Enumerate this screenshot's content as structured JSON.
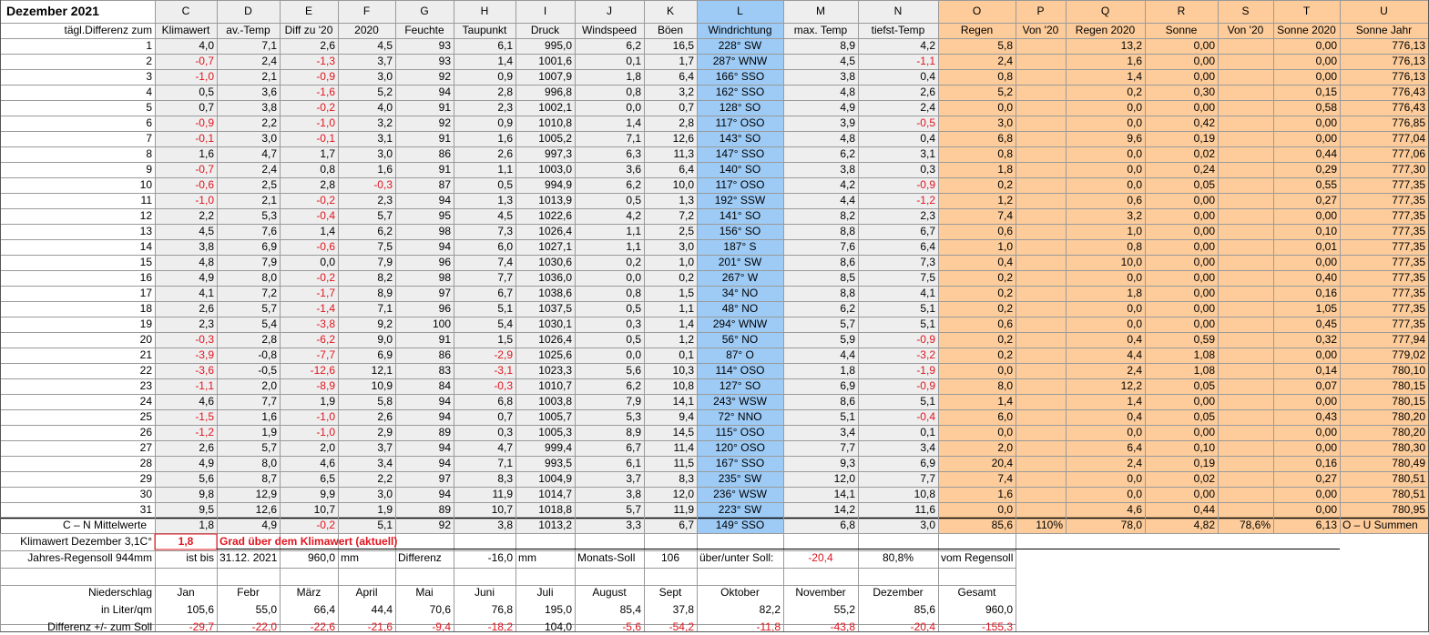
{
  "title": "Dezember 2021",
  "colors": {
    "gray": "#eeeeee",
    "blue": "#9dcbf6",
    "orange": "#fdcc9a",
    "red": "#e0141e",
    "grid": "#9a9a9a"
  },
  "letters": [
    "C",
    "D",
    "E",
    "F",
    "G",
    "H",
    "I",
    "J",
    "K",
    "L",
    "M",
    "N",
    "O",
    "P",
    "Q",
    "R",
    "S",
    "T",
    "U"
  ],
  "headers": [
    "Klimawert",
    "av.-Temp",
    "Diff zu '20",
    "2020",
    "Feuchte",
    "Taupunkt",
    "Druck",
    "Windspeed",
    "Böen",
    "Windrichtung",
    "max. Temp",
    "tiefst-Temp",
    "Regen",
    "Von '20",
    "Regen 2020",
    "Sonne",
    "Von '20",
    "Sonne 2020",
    "Sonne Jahr"
  ],
  "row_header_label": "tägl.Differenz zum",
  "rows": [
    [
      "1",
      "4,0",
      "7,1",
      "2,6",
      "4,5",
      "93",
      "6,1",
      "995,0",
      "6,2",
      "16,5",
      "228° SW",
      "8,9",
      "4,2",
      "5,8",
      "",
      "13,2",
      "0,00",
      "",
      "0,00",
      "776,13"
    ],
    [
      "2",
      "-0,7",
      "2,4",
      "-1,3",
      "3,7",
      "93",
      "1,4",
      "1001,6",
      "0,1",
      "1,7",
      "287° WNW",
      "4,5",
      "-1,1",
      "2,4",
      "",
      "1,6",
      "0,00",
      "",
      "0,00",
      "776,13"
    ],
    [
      "3",
      "-1,0",
      "2,1",
      "-0,9",
      "3,0",
      "92",
      "0,9",
      "1007,9",
      "1,8",
      "6,4",
      "166° SSO",
      "3,8",
      "0,4",
      "0,8",
      "",
      "1,4",
      "0,00",
      "",
      "0,00",
      "776,13"
    ],
    [
      "4",
      "0,5",
      "3,6",
      "-1,6",
      "5,2",
      "94",
      "2,8",
      "996,8",
      "0,8",
      "3,2",
      "162° SSO",
      "4,8",
      "2,6",
      "5,2",
      "",
      "0,2",
      "0,30",
      "",
      "0,15",
      "776,43"
    ],
    [
      "5",
      "0,7",
      "3,8",
      "-0,2",
      "4,0",
      "91",
      "2,3",
      "1002,1",
      "0,0",
      "0,7",
      "128° SO",
      "4,9",
      "2,4",
      "0,0",
      "",
      "0,0",
      "0,00",
      "",
      "0,58",
      "776,43"
    ],
    [
      "6",
      "-0,9",
      "2,2",
      "-1,0",
      "3,2",
      "92",
      "0,9",
      "1010,8",
      "1,4",
      "2,8",
      "117° OSO",
      "3,9",
      "-0,5",
      "3,0",
      "",
      "0,0",
      "0,42",
      "",
      "0,00",
      "776,85"
    ],
    [
      "7",
      "-0,1",
      "3,0",
      "-0,1",
      "3,1",
      "91",
      "1,6",
      "1005,2",
      "7,1",
      "12,6",
      "143° SO",
      "4,8",
      "0,4",
      "6,8",
      "",
      "9,6",
      "0,19",
      "",
      "0,00",
      "777,04"
    ],
    [
      "8",
      "1,6",
      "4,7",
      "1,7",
      "3,0",
      "86",
      "2,6",
      "997,3",
      "6,3",
      "11,3",
      "147° SSO",
      "6,2",
      "3,1",
      "0,8",
      "",
      "0,0",
      "0,02",
      "",
      "0,44",
      "777,06"
    ],
    [
      "9",
      "-0,7",
      "2,4",
      "0,8",
      "1,6",
      "91",
      "1,1",
      "1003,0",
      "3,6",
      "6,4",
      "140° SO",
      "3,8",
      "0,3",
      "1,8",
      "",
      "0,0",
      "0,24",
      "",
      "0,29",
      "777,30"
    ],
    [
      "10",
      "-0,6",
      "2,5",
      "2,8",
      "-0,3",
      "87",
      "0,5",
      "994,9",
      "6,2",
      "10,0",
      "117° OSO",
      "4,2",
      "-0,9",
      "0,2",
      "",
      "0,0",
      "0,05",
      "",
      "0,55",
      "777,35"
    ],
    [
      "11",
      "-1,0",
      "2,1",
      "-0,2",
      "2,3",
      "94",
      "1,3",
      "1013,9",
      "0,5",
      "1,3",
      "192° SSW",
      "4,4",
      "-1,2",
      "1,2",
      "",
      "0,6",
      "0,00",
      "",
      "0,27",
      "777,35"
    ],
    [
      "12",
      "2,2",
      "5,3",
      "-0,4",
      "5,7",
      "95",
      "4,5",
      "1022,6",
      "4,2",
      "7,2",
      "141° SO",
      "8,2",
      "2,3",
      "7,4",
      "",
      "3,2",
      "0,00",
      "",
      "0,00",
      "777,35"
    ],
    [
      "13",
      "4,5",
      "7,6",
      "1,4",
      "6,2",
      "98",
      "7,3",
      "1026,4",
      "1,1",
      "2,5",
      "156° SO",
      "8,8",
      "6,7",
      "0,6",
      "",
      "1,0",
      "0,00",
      "",
      "0,10",
      "777,35"
    ],
    [
      "14",
      "3,8",
      "6,9",
      "-0,6",
      "7,5",
      "94",
      "6,0",
      "1027,1",
      "1,1",
      "3,0",
      "187° S",
      "7,6",
      "6,4",
      "1,0",
      "",
      "0,8",
      "0,00",
      "",
      "0,01",
      "777,35"
    ],
    [
      "15",
      "4,8",
      "7,9",
      "0,0",
      "7,9",
      "96",
      "7,4",
      "1030,6",
      "0,2",
      "1,0",
      "201° SW",
      "8,6",
      "7,3",
      "0,4",
      "",
      "10,0",
      "0,00",
      "",
      "0,00",
      "777,35"
    ],
    [
      "16",
      "4,9",
      "8,0",
      "-0,2",
      "8,2",
      "98",
      "7,7",
      "1036,0",
      "0,0",
      "0,2",
      "267° W",
      "8,5",
      "7,5",
      "0,2",
      "",
      "0,0",
      "0,00",
      "",
      "0,40",
      "777,35"
    ],
    [
      "17",
      "4,1",
      "7,2",
      "-1,7",
      "8,9",
      "97",
      "6,7",
      "1038,6",
      "0,8",
      "1,5",
      "34° NO",
      "8,8",
      "4,1",
      "0,2",
      "",
      "1,8",
      "0,00",
      "",
      "0,16",
      "777,35"
    ],
    [
      "18",
      "2,6",
      "5,7",
      "-1,4",
      "7,1",
      "96",
      "5,1",
      "1037,5",
      "0,5",
      "1,1",
      "48° NO",
      "6,2",
      "5,1",
      "0,2",
      "",
      "0,0",
      "0,00",
      "",
      "1,05",
      "777,35"
    ],
    [
      "19",
      "2,3",
      "5,4",
      "-3,8",
      "9,2",
      "100",
      "5,4",
      "1030,1",
      "0,3",
      "1,4",
      "294° WNW",
      "5,7",
      "5,1",
      "0,6",
      "",
      "0,0",
      "0,00",
      "",
      "0,45",
      "777,35"
    ],
    [
      "20",
      "-0,3",
      "2,8",
      "-6,2",
      "9,0",
      "91",
      "1,5",
      "1026,4",
      "0,5",
      "1,2",
      "56° NO",
      "5,9",
      "-0,9",
      "0,2",
      "",
      "0,4",
      "0,59",
      "",
      "0,32",
      "777,94"
    ],
    [
      "21",
      "-3,9",
      "-0,8",
      "-7,7",
      "6,9",
      "86",
      "-2,9",
      "1025,6",
      "0,0",
      "0,1",
      "87° O",
      "4,4",
      "-3,2",
      "0,2",
      "",
      "4,4",
      "1,08",
      "",
      "0,00",
      "779,02"
    ],
    [
      "22",
      "-3,6",
      "-0,5",
      "-12,6",
      "12,1",
      "83",
      "-3,1",
      "1023,3",
      "5,6",
      "10,3",
      "114° OSO",
      "1,8",
      "-1,9",
      "0,0",
      "",
      "2,4",
      "1,08",
      "",
      "0,14",
      "780,10"
    ],
    [
      "23",
      "-1,1",
      "2,0",
      "-8,9",
      "10,9",
      "84",
      "-0,3",
      "1010,7",
      "6,2",
      "10,8",
      "127° SO",
      "6,9",
      "-0,9",
      "8,0",
      "",
      "12,2",
      "0,05",
      "",
      "0,07",
      "780,15"
    ],
    [
      "24",
      "4,6",
      "7,7",
      "1,9",
      "5,8",
      "94",
      "6,8",
      "1003,8",
      "7,9",
      "14,1",
      "243° WSW",
      "8,6",
      "5,1",
      "1,4",
      "",
      "1,4",
      "0,00",
      "",
      "0,00",
      "780,15"
    ],
    [
      "25",
      "-1,5",
      "1,6",
      "-1,0",
      "2,6",
      "94",
      "0,7",
      "1005,7",
      "5,3",
      "9,4",
      "72° NNO",
      "5,1",
      "-0,4",
      "6,0",
      "",
      "0,4",
      "0,05",
      "",
      "0,43",
      "780,20"
    ],
    [
      "26",
      "-1,2",
      "1,9",
      "-1,0",
      "2,9",
      "89",
      "0,3",
      "1005,3",
      "8,9",
      "14,5",
      "115° OSO",
      "3,4",
      "0,1",
      "0,0",
      "",
      "0,0",
      "0,00",
      "",
      "0,00",
      "780,20"
    ],
    [
      "27",
      "2,6",
      "5,7",
      "2,0",
      "3,7",
      "94",
      "4,7",
      "999,4",
      "6,7",
      "11,4",
      "120° OSO",
      "7,7",
      "3,4",
      "2,0",
      "",
      "6,4",
      "0,10",
      "",
      "0,00",
      "780,30"
    ],
    [
      "28",
      "4,9",
      "8,0",
      "4,6",
      "3,4",
      "94",
      "7,1",
      "993,5",
      "6,1",
      "11,5",
      "167° SSO",
      "9,3",
      "6,9",
      "20,4",
      "",
      "2,4",
      "0,19",
      "",
      "0,16",
      "780,49"
    ],
    [
      "29",
      "5,6",
      "8,7",
      "6,5",
      "2,2",
      "97",
      "8,3",
      "1004,9",
      "3,7",
      "8,3",
      "235° SW",
      "12,0",
      "7,7",
      "7,4",
      "",
      "0,0",
      "0,02",
      "",
      "0,27",
      "780,51"
    ],
    [
      "30",
      "9,8",
      "12,9",
      "9,9",
      "3,0",
      "94",
      "11,9",
      "1014,7",
      "3,8",
      "12,0",
      "236° WSW",
      "14,1",
      "10,8",
      "1,6",
      "",
      "0,0",
      "0,00",
      "",
      "0,00",
      "780,51"
    ],
    [
      "31",
      "9,5",
      "12,6",
      "10,7",
      "1,9",
      "89",
      "10,7",
      "1018,8",
      "5,7",
      "11,9",
      "223° SW",
      "14,2",
      "11,6",
      "0,0",
      "",
      "4,6",
      "0,44",
      "",
      "0,00",
      "780,95"
    ]
  ],
  "summary": {
    "label": "C – N Mittelwerte",
    "values": [
      "1,8",
      "4,9",
      "-0,2",
      "5,1",
      "92",
      "3,8",
      "1013,2",
      "3,3",
      "6,7",
      "149° SSO",
      "6,8",
      "3,0",
      "85,6",
      "110%",
      "78,0",
      "4,82",
      "78,6%",
      "6,13",
      "O – U Summen"
    ]
  },
  "klimawert": {
    "label": "Klimawert Dezember 3,1C°",
    "value": "1,8",
    "note": "Grad über dem Klimawert (aktuell)"
  },
  "regensoll": {
    "label": "Jahres-Regensoll 944mm",
    "ist_bis": "ist bis",
    "date": "31.12. 2021",
    "amount": "960,0",
    "unit1": "mm",
    "diff_label": "Differenz",
    "diff": "-16,0",
    "unit2": "mm",
    "monats_label": "Monats-Soll",
    "monats": "106",
    "ueber_label": "über/unter Soll:",
    "ueber": "-20,4",
    "percent": "80,8%",
    "vom": "vom Regensoll"
  },
  "niederschlag": {
    "label": "Niederschlag",
    "months": [
      "Jan",
      "Febr",
      "März",
      "April",
      "Mai",
      "Juni",
      "Juli",
      "August",
      "Sept",
      "Oktober",
      "November",
      "Dezember",
      "Gesamt"
    ],
    "liter_label": "in Liter/qm",
    "liter": [
      "105,6",
      "55,0",
      "66,4",
      "44,4",
      "70,6",
      "76,8",
      "195,0",
      "85,4",
      "37,8",
      "82,2",
      "55,2",
      "85,6",
      "960,0"
    ],
    "diff_label": "Differenz  +/- zum Soll",
    "diff": [
      "-29,7",
      "-22,0",
      "-22,6",
      "-21,6",
      "-9,4",
      "-18,2",
      "104,0",
      "-5,6",
      "-54,2",
      "-11,8",
      "-43,8",
      "-20,4",
      "-155,3"
    ]
  }
}
